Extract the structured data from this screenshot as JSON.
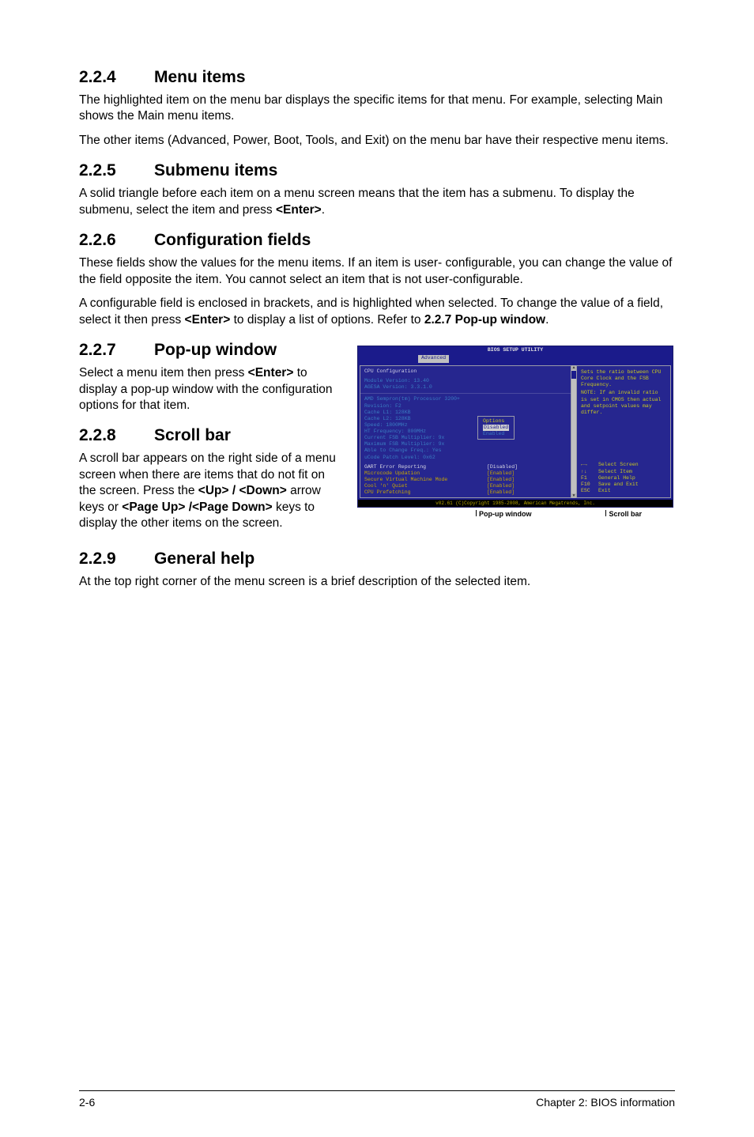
{
  "s224": {
    "num": "2.2.4",
    "title": "Menu items",
    "p1": "The highlighted item on the menu bar displays the specific items for that menu. For example, selecting Main shows the Main menu items.",
    "p2": "The other items (Advanced, Power, Boot, Tools, and Exit) on the menu bar have their respective menu items."
  },
  "s225": {
    "num": "2.2.5",
    "title": "Submenu items",
    "p1a": "A solid triangle before each item on a menu screen means that the item has a submenu. To display the submenu, select the item and press ",
    "p1b": "<Enter>",
    "p1c": "."
  },
  "s226": {
    "num": "2.2.6",
    "title": "Configuration fields",
    "p1": "These fields show the values for the menu items. If an item is user- configurable, you can change the value of the field opposite the item. You cannot select an item that is not user-configurable.",
    "p2a": "A configurable field is enclosed in brackets, and is highlighted when selected. To change the value of a field, select it then press ",
    "p2b": "<Enter>",
    "p2c": " to display a list of options. Refer to ",
    "p2d": "2.2.7 Pop-up window",
    "p2e": "."
  },
  "s227": {
    "num": "2.2.7",
    "title": "Pop-up window",
    "p1a": "Select a menu item then press ",
    "p1b": "<Enter>",
    "p1c": " to display a pop-up window with the configuration options for that item."
  },
  "s228": {
    "num": "2.2.8",
    "title": "Scroll bar",
    "p1a": "A scroll bar appears on the right side of a menu screen when there are items that do not fit on the screen. Press the ",
    "p1b": "<Up> / <Down>",
    "p1c": " arrow keys or ",
    "p1d": "<Page Up> /<Page Down>",
    "p1e": " keys to display the other items on the screen."
  },
  "s229": {
    "num": "2.2.9",
    "title": "General help",
    "p1": "At the top right corner of the menu screen is a brief description of the selected item."
  },
  "footer": {
    "left": "2-6",
    "right": "Chapter 2: BIOS information"
  },
  "bios": {
    "title": "BIOS SETUP UTILITY",
    "tab": "Advanced",
    "footer": "v02.61 (C)Copyright 1985-2008, American Megatrends, Inc.",
    "captions": {
      "popup": "Pop-up window",
      "scroll": "Scroll bar"
    },
    "main_hdr": "CPU Configuration",
    "info1": "Module Version: 13.40",
    "info2": "AGESA Version: 3.3.1.0",
    "cpu1": "AMD Sempron(tm) Processor 3200+",
    "cpu2": "Revision: F2",
    "cpu3": "Cache L1:  128KB",
    "cpu4": "Cache L2:  128KB",
    "cpu5": "Speed: 1800MHz",
    "cpu6": "HT Frequency: 800MHz",
    "cpu7": "Current FSB Multiplier: 9x",
    "cpu8": "Maximum FSB Multiplier: 9x",
    "cpu9": "Able to Change Freq.: Yes",
    "cpu10": "uCode Patch Level: 0x62",
    "opt1": {
      "k": "GART Error Reporting",
      "v": "[Disabled]"
    },
    "opt2": {
      "k": "Microcode Updation",
      "v": "[Enabled]"
    },
    "opt3": {
      "k": "Secure Virtual Machine Mode",
      "v": "[Enabled]"
    },
    "opt4": {
      "k": "Cool 'n' Quiet",
      "v": "[Enabled]"
    },
    "opt5": {
      "k": "CPU Prefetching",
      "v": "[Enabled]"
    },
    "popup": {
      "hdr": "Options",
      "sel": "Disabled",
      "alt": "Enabled"
    },
    "help1": "Sets the ratio between CPU Core Clock and the FSB Frequency.",
    "help2": "NOTE: If an invalid ratio is set in CMOS then actual and setpoint values may differ.",
    "keys": {
      "k1": {
        "i": "←→",
        "t": "Select Screen"
      },
      "k2": {
        "i": "↑↓",
        "t": "Select Item"
      },
      "k3": {
        "i": "F1",
        "t": "General Help"
      },
      "k4": {
        "i": "F10",
        "t": "Save and Exit"
      },
      "k5": {
        "i": "ESC",
        "t": "Exit"
      }
    }
  }
}
